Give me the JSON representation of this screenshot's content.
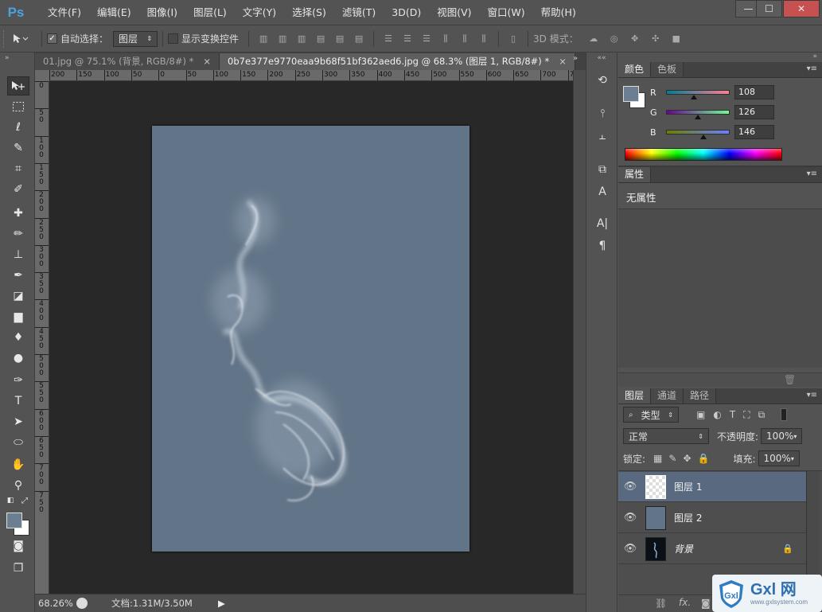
{
  "app": {
    "logo_text": "Ps",
    "menus": [
      "文件(F)",
      "编辑(E)",
      "图像(I)",
      "图层(L)",
      "文字(Y)",
      "选择(S)",
      "滤镜(T)",
      "3D(D)",
      "视图(V)",
      "窗口(W)",
      "帮助(H)"
    ],
    "window_controls": {
      "minimize": "—",
      "maximize": "☐",
      "close": "✕"
    }
  },
  "options_bar": {
    "auto_select_label": "自动选择：",
    "auto_select_checked": true,
    "auto_select_target": "图层",
    "show_transform_label": "显示变换控件",
    "show_transform_checked": false,
    "mode_3d_label": "3D 模式："
  },
  "tabs": [
    {
      "title": "01.jpg @ 75.1% (背景, RGB/8#) *",
      "active": false
    },
    {
      "title": "0b7e377e9770eaa9b68f51bf362aed6.jpg @ 68.3% (图层 1, RGB/8#) *",
      "active": true
    }
  ],
  "rulers": {
    "horizontal": [
      "200",
      "150",
      "100",
      "50",
      "0",
      "50",
      "100",
      "150",
      "200",
      "250",
      "300",
      "350",
      "400",
      "450",
      "500",
      "550",
      "600",
      "650",
      "700",
      "750"
    ],
    "vertical": [
      "0",
      "5 0",
      "1 0 0",
      "1 5 0",
      "2 0 0",
      "2 5 0",
      "3 0 0",
      "3 5 0",
      "4 0 0",
      "4 5 0",
      "5 0 0",
      "5 5 0",
      "6 0 0",
      "6 5 0",
      "7 0 0",
      "7 5 0"
    ]
  },
  "status": {
    "zoom": "68.26%",
    "doc_info": "文档:1.31M/3.50M"
  },
  "color_panel": {
    "tabs": [
      "颜色",
      "色板"
    ],
    "channels": [
      {
        "label": "R",
        "value": "108",
        "fraction": 0.42
      },
      {
        "label": "G",
        "value": "126",
        "fraction": 0.49
      },
      {
        "label": "B",
        "value": "146",
        "fraction": 0.57
      }
    ],
    "foreground": "#6c7e92",
    "background": "#ffffff"
  },
  "properties_panel": {
    "tab": "属性",
    "empty_text": "无属性"
  },
  "layers_panel": {
    "tabs": [
      "图层",
      "通道",
      "路径"
    ],
    "filter_label": "类型",
    "blend_mode": "正常",
    "opacity_label": "不透明度:",
    "opacity_value": "100%",
    "lock_label": "锁定:",
    "fill_label": "填充:",
    "fill_value": "100%",
    "layers": [
      {
        "name": "图层 1",
        "active": true
      },
      {
        "name": "图层 2",
        "active": false
      },
      {
        "name": "背景",
        "active": false
      }
    ]
  },
  "watermark": {
    "brand": "Gxl 网",
    "url": "www.gxlsystem.com"
  },
  "colors": {
    "accent": "#4aa3df",
    "canvas": "#627487",
    "layer_selected": "#596a80"
  }
}
